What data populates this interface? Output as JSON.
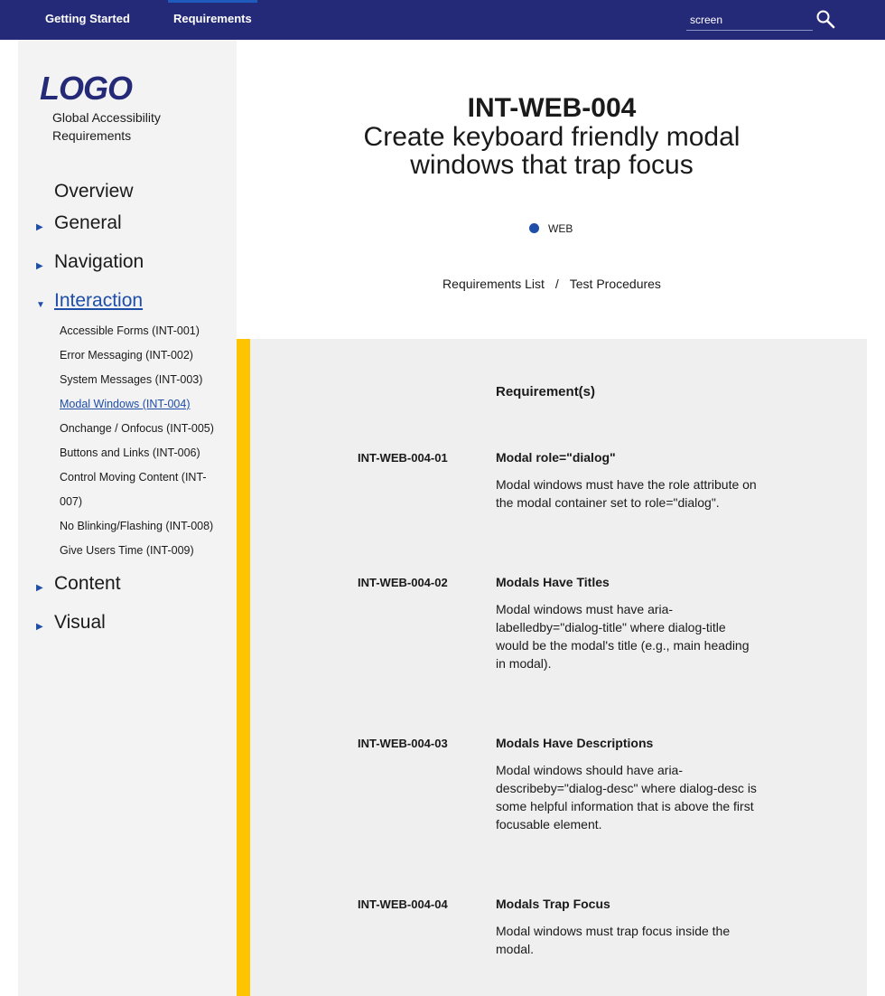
{
  "topnav": {
    "links": [
      "Getting Started",
      "Requirements"
    ],
    "search_value": "screen",
    "search_icon": "search-icon"
  },
  "sidebar": {
    "logo": "LOGO",
    "site_name": "Global Accessibility Requirements",
    "overview": "Overview",
    "sections": [
      {
        "label": "General",
        "expanded": false
      },
      {
        "label": "Navigation",
        "expanded": false
      },
      {
        "label": "Interaction",
        "expanded": true
      },
      {
        "label": "Content",
        "expanded": false
      },
      {
        "label": "Visual",
        "expanded": false
      }
    ],
    "interaction_items": [
      "Accessible Forms (INT-001)",
      "Error Messaging (INT-002)",
      "System Messages (INT-003)",
      "Modal Windows (INT-004)",
      "Onchange / Onfocus (INT-005)",
      "Buttons and Links (INT-006)",
      "Control Moving Content (INT-007)",
      "No Blinking/Flashing (INT-008)",
      "Give Users Time (INT-009)"
    ],
    "current_item": "Modal Windows (INT-004)"
  },
  "header": {
    "id": "INT-WEB-004",
    "title": "Create keyboard friendly modal windows that trap focus",
    "tag": "WEB",
    "breadcrumbs": [
      "Requirements List",
      "Test Procedures"
    ],
    "breadcrumb_separator": "/"
  },
  "colors": {
    "topbar": "#252a78",
    "accent_blue": "#1e4ea8",
    "accent_yellow": "#ffc400",
    "sidebar_bg": "#f3f3f3",
    "panel_bg": "#efefef"
  },
  "requirements": {
    "heading": "Requirement(s)",
    "items": [
      {
        "id": "INT-WEB-004-01",
        "title": "Modal role=\"dialog\"",
        "description": "Modal windows must have the role attribute on the modal container set to role=\"dialog\"."
      },
      {
        "id": "INT-WEB-004-02",
        "title": "Modals Have Titles",
        "description": "Modal windows must have aria-labelledby=\"dialog-title\" where dialog-title would be the modal's title (e.g., main heading in modal)."
      },
      {
        "id": "INT-WEB-004-03",
        "title": "Modals Have Descriptions",
        "description": "Modal windows should have aria-describeby=\"dialog-desc\" where dialog-desc is some helpful information that is above the first focusable element."
      },
      {
        "id": "INT-WEB-004-04",
        "title": "Modals Trap Focus",
        "description": "Modal windows must trap focus inside the modal."
      }
    ]
  }
}
